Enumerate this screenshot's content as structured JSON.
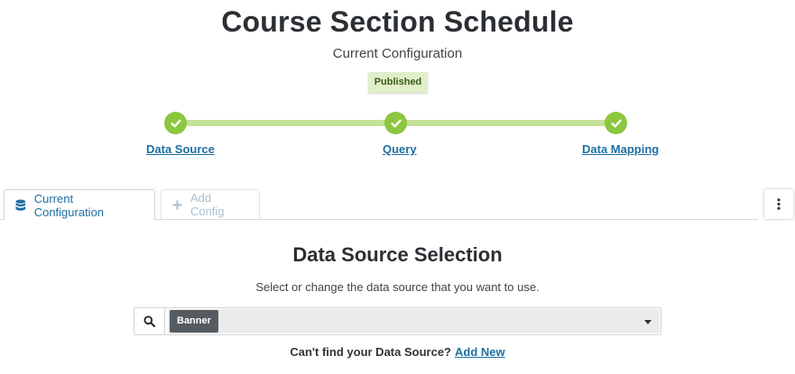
{
  "page": {
    "title": "Course Section Schedule",
    "subtitle": "Current Configuration",
    "status": "Published"
  },
  "steps": [
    {
      "label": "Data Source",
      "state": "complete"
    },
    {
      "label": "Query",
      "state": "complete"
    },
    {
      "label": "Data Mapping",
      "state": "complete"
    }
  ],
  "tabs": {
    "current": {
      "label": "Current Configuration",
      "icon": "database-icon"
    },
    "add": {
      "label": "Add Config",
      "icon": "plus-icon"
    }
  },
  "menu": {
    "icon": "vertical-ellipsis-icon"
  },
  "section": {
    "title": "Data Source Selection",
    "description": "Select or change the data source that you want to use.",
    "selected_source": "Banner",
    "search_icon": "search-icon"
  },
  "footer": {
    "prompt": "Can't find your Data Source?",
    "link": "Add New"
  },
  "colors": {
    "step_complete": "#8dc63f",
    "progress_track": "#c5e29a",
    "link": "#1e6fa3",
    "badge_bg": "#e1efcb",
    "chip_bg": "#555b61"
  }
}
